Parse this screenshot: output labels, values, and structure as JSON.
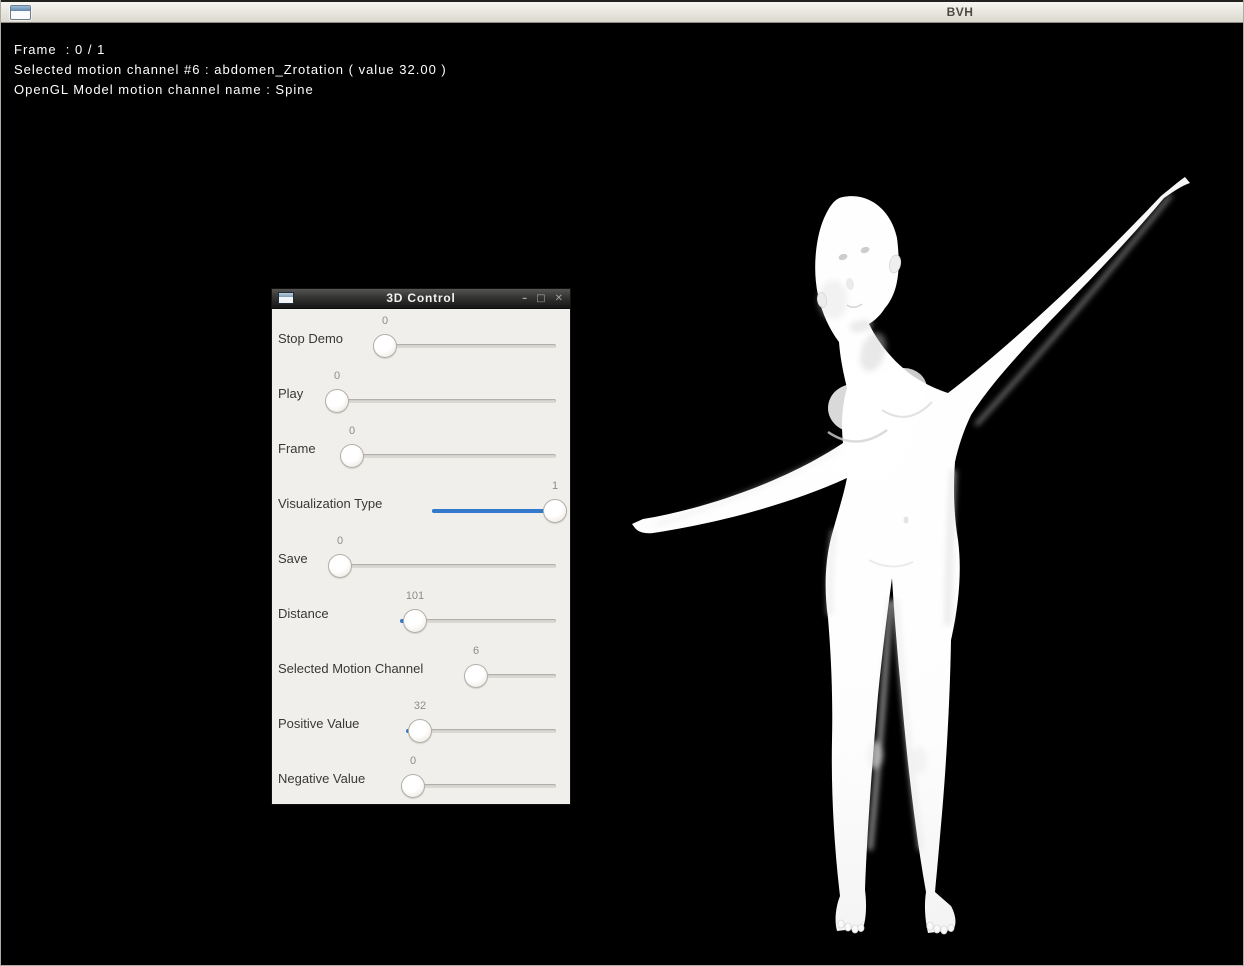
{
  "window": {
    "title": "BVH"
  },
  "hud": {
    "lines": [
      "Frame  : 0 / 1",
      "Selected motion channel #6 : abdomen_Zrotation ( value 32.00 )",
      "OpenGL Model motion channel name : Spine"
    ]
  },
  "control_window": {
    "title": "3D Control",
    "window_controls": {
      "minimize": "–",
      "maximize": "□",
      "close": "✕"
    },
    "sliders": [
      {
        "label": "Stop Demo",
        "value": "0"
      },
      {
        "label": "Play",
        "value": "0"
      },
      {
        "label": "Frame",
        "value": "0"
      },
      {
        "label": "Visualization Type",
        "value": "1"
      },
      {
        "label": "Save",
        "value": "0"
      },
      {
        "label": "Distance",
        "value": "101"
      },
      {
        "label": "Selected Motion Channel",
        "value": "6"
      },
      {
        "label": "Positive Value",
        "value": "32"
      },
      {
        "label": "Negative Value",
        "value": "0"
      }
    ]
  },
  "scene": {
    "description": "white 3D female figure, arms outstretched, standing on black background",
    "background": "#000000"
  },
  "colors": {
    "accent_blue": "#3278cb",
    "panel_background": "#f1efeb",
    "titlebar_light": "#e7e5dc",
    "hud_text": "#ffffff"
  }
}
